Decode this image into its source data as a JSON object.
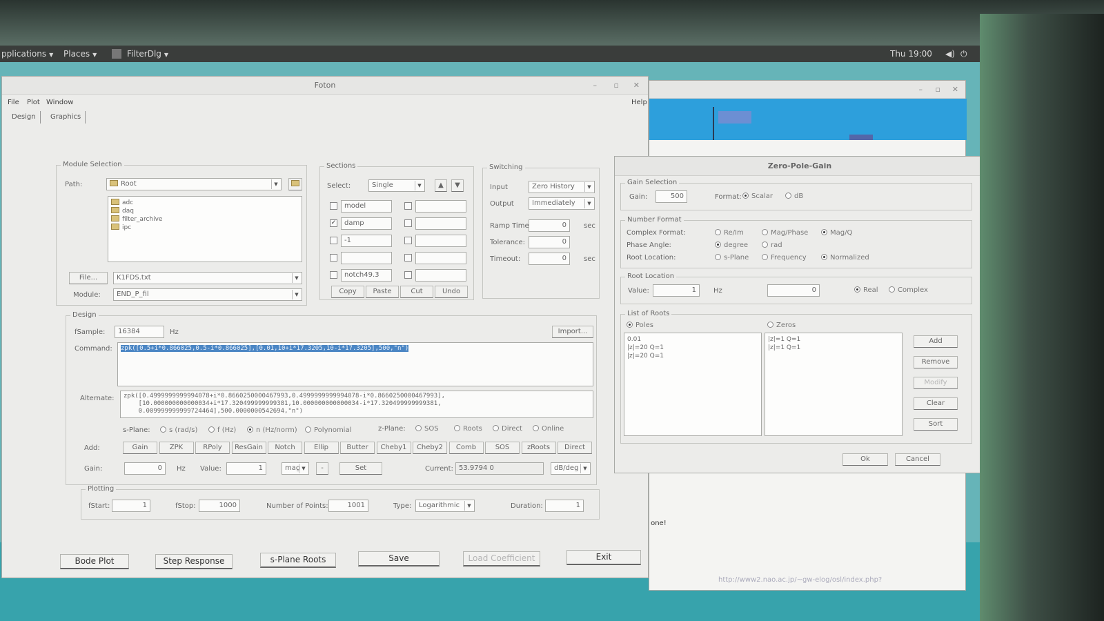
{
  "top_panel": {
    "applications": "pplications",
    "places": "Places",
    "task": "FilterDlg",
    "clock": "Thu 19:00"
  },
  "foton": {
    "title": "Foton",
    "menu": {
      "file": "File",
      "plot": "Plot",
      "window": "Window",
      "help": "Help"
    },
    "tabs": {
      "design": "Design",
      "graphics": "Graphics"
    },
    "module_selection": {
      "label": "Module Selection",
      "path_label": "Path:",
      "path_value": "Root",
      "tree": [
        "adc",
        "daq",
        "filter_archive",
        "ipc"
      ],
      "file_button": "File...",
      "file_value": "K1FDS.txt",
      "module_label": "Module:",
      "module_value": "END_P_fil"
    },
    "sections": {
      "label": "Sections",
      "select_label": "Select:",
      "select_value": "Single",
      "rows": [
        {
          "checked": false,
          "name": "model",
          "name2": ""
        },
        {
          "checked": true,
          "name": "damp",
          "name2": ""
        },
        {
          "checked": false,
          "name": "-1",
          "name2": ""
        },
        {
          "checked": false,
          "name": "",
          "name2": ""
        },
        {
          "checked": false,
          "name": "notch49.3",
          "name2": ""
        }
      ],
      "copy": "Copy",
      "paste": "Paste",
      "cut": "Cut",
      "undo": "Undo"
    },
    "switching": {
      "label": "Switching",
      "input_label": "Input",
      "input_value": "Zero History",
      "output_label": "Output",
      "output_value": "Immediately",
      "ramp_label": "Ramp Time:",
      "ramp_value": "0",
      "ramp_unit": "sec",
      "tolerance_label": "Tolerance:",
      "tolerance_value": "0",
      "timeout_label": "Timeout:",
      "timeout_value": "0",
      "timeout_unit": "sec"
    },
    "design": {
      "label": "Design",
      "fsample_label": "fSample:",
      "fsample_value": "16384",
      "fsample_unit": "Hz",
      "import": "Import...",
      "command_label": "Command:",
      "command_value": "zpk([0.5+i*0.866025,0.5-i*0.866025],[0.01,10+i*17.3205,10-i*17.3205],500,\"n\")",
      "alternate_label": "Alternate:",
      "alternate_lines": [
        "zpk([0.4999999999994078+i*0.8660250000467993,0.4999999999994078-i*0.8660250000467993],",
        "    [10.000000000000034+i*17.320499999999381,10.000000000000034-i*17.320499999999381,",
        "    0.009999999999724464],500.0000000542694,\"n\")"
      ],
      "splane_label": "s-Plane:",
      "splane_opts": [
        "s (rad/s)",
        "f (Hz)",
        "n (Hz/norm)",
        "Polynomial"
      ],
      "zplane_label": "z-Plane:",
      "zplane_opts": [
        "SOS",
        "Roots",
        "Direct",
        "Online"
      ],
      "add_label": "Add:",
      "add_buttons": [
        "Gain",
        "ZPK",
        "RPoly",
        "ResGain",
        "Notch",
        "Ellip",
        "Butter",
        "Cheby1",
        "Cheby2",
        "Comb",
        "SOS",
        "zRoots",
        "Direct"
      ],
      "gain_label": "Gain:",
      "gain_value": "0",
      "gain_unit": "Hz",
      "value_label": "Value:",
      "value_value": "1",
      "value_unit": "mag",
      "value_sign": "-",
      "set": "Set",
      "current_label": "Current:",
      "current_value": "53.9794  0",
      "current_unit": "dB/deg"
    },
    "plotting": {
      "label": "Plotting",
      "fstart_label": "fStart:",
      "fstart_value": "1",
      "fstop_label": "fStop:",
      "fstop_value": "1000",
      "npoints_label": "Number of Points:",
      "npoints_value": "1001",
      "type_label": "Type:",
      "type_value": "Logarithmic",
      "duration_label": "Duration:",
      "duration_value": "1"
    },
    "bottom": {
      "bode": "Bode Plot",
      "step": "Step Response",
      "splane": "s-Plane Roots",
      "save": "Save",
      "load": "Load Coefficient",
      "exit": "Exit"
    }
  },
  "zpg": {
    "title": "Zero-Pole-Gain",
    "gain_group": "Gain Selection",
    "gain_label": "Gain:",
    "gain_value": "500",
    "format_label": "Format:",
    "format_scalar": "Scalar",
    "format_db": "dB",
    "number_format_group": "Number Format",
    "complex_label": "Complex Format:",
    "complex_opts": [
      "Re/Im",
      "Mag/Phase",
      "Mag/Q"
    ],
    "phase_label": "Phase Angle:",
    "phase_opts": [
      "degree",
      "rad"
    ],
    "rootloc_label": "Root Location:",
    "rootloc_opts": [
      "s-Plane",
      "Frequency",
      "Normalized"
    ],
    "root_location_group": "Root Location",
    "value_label": "Value:",
    "value_value": "1",
    "value_unit": "Hz",
    "value2": "0",
    "real": "Real",
    "complex": "Complex",
    "list_group": "List of Roots",
    "poles_label": "Poles",
    "zeros_label": "Zeros",
    "poles": [
      "0.01",
      "|z|=20 Q=1",
      "|z|=20 Q=1"
    ],
    "zeros": [
      "|z|=1 Q=1",
      "|z|=1 Q=1"
    ],
    "add": "Add",
    "remove": "Remove",
    "modify": "Modify",
    "clear": "Clear",
    "sort": "Sort",
    "ok": "Ok",
    "cancel": "Cancel"
  },
  "background": {
    "note": "al one!",
    "url": "http://www2.nao.ac.jp/~gw-elog/osl/index.php?"
  }
}
